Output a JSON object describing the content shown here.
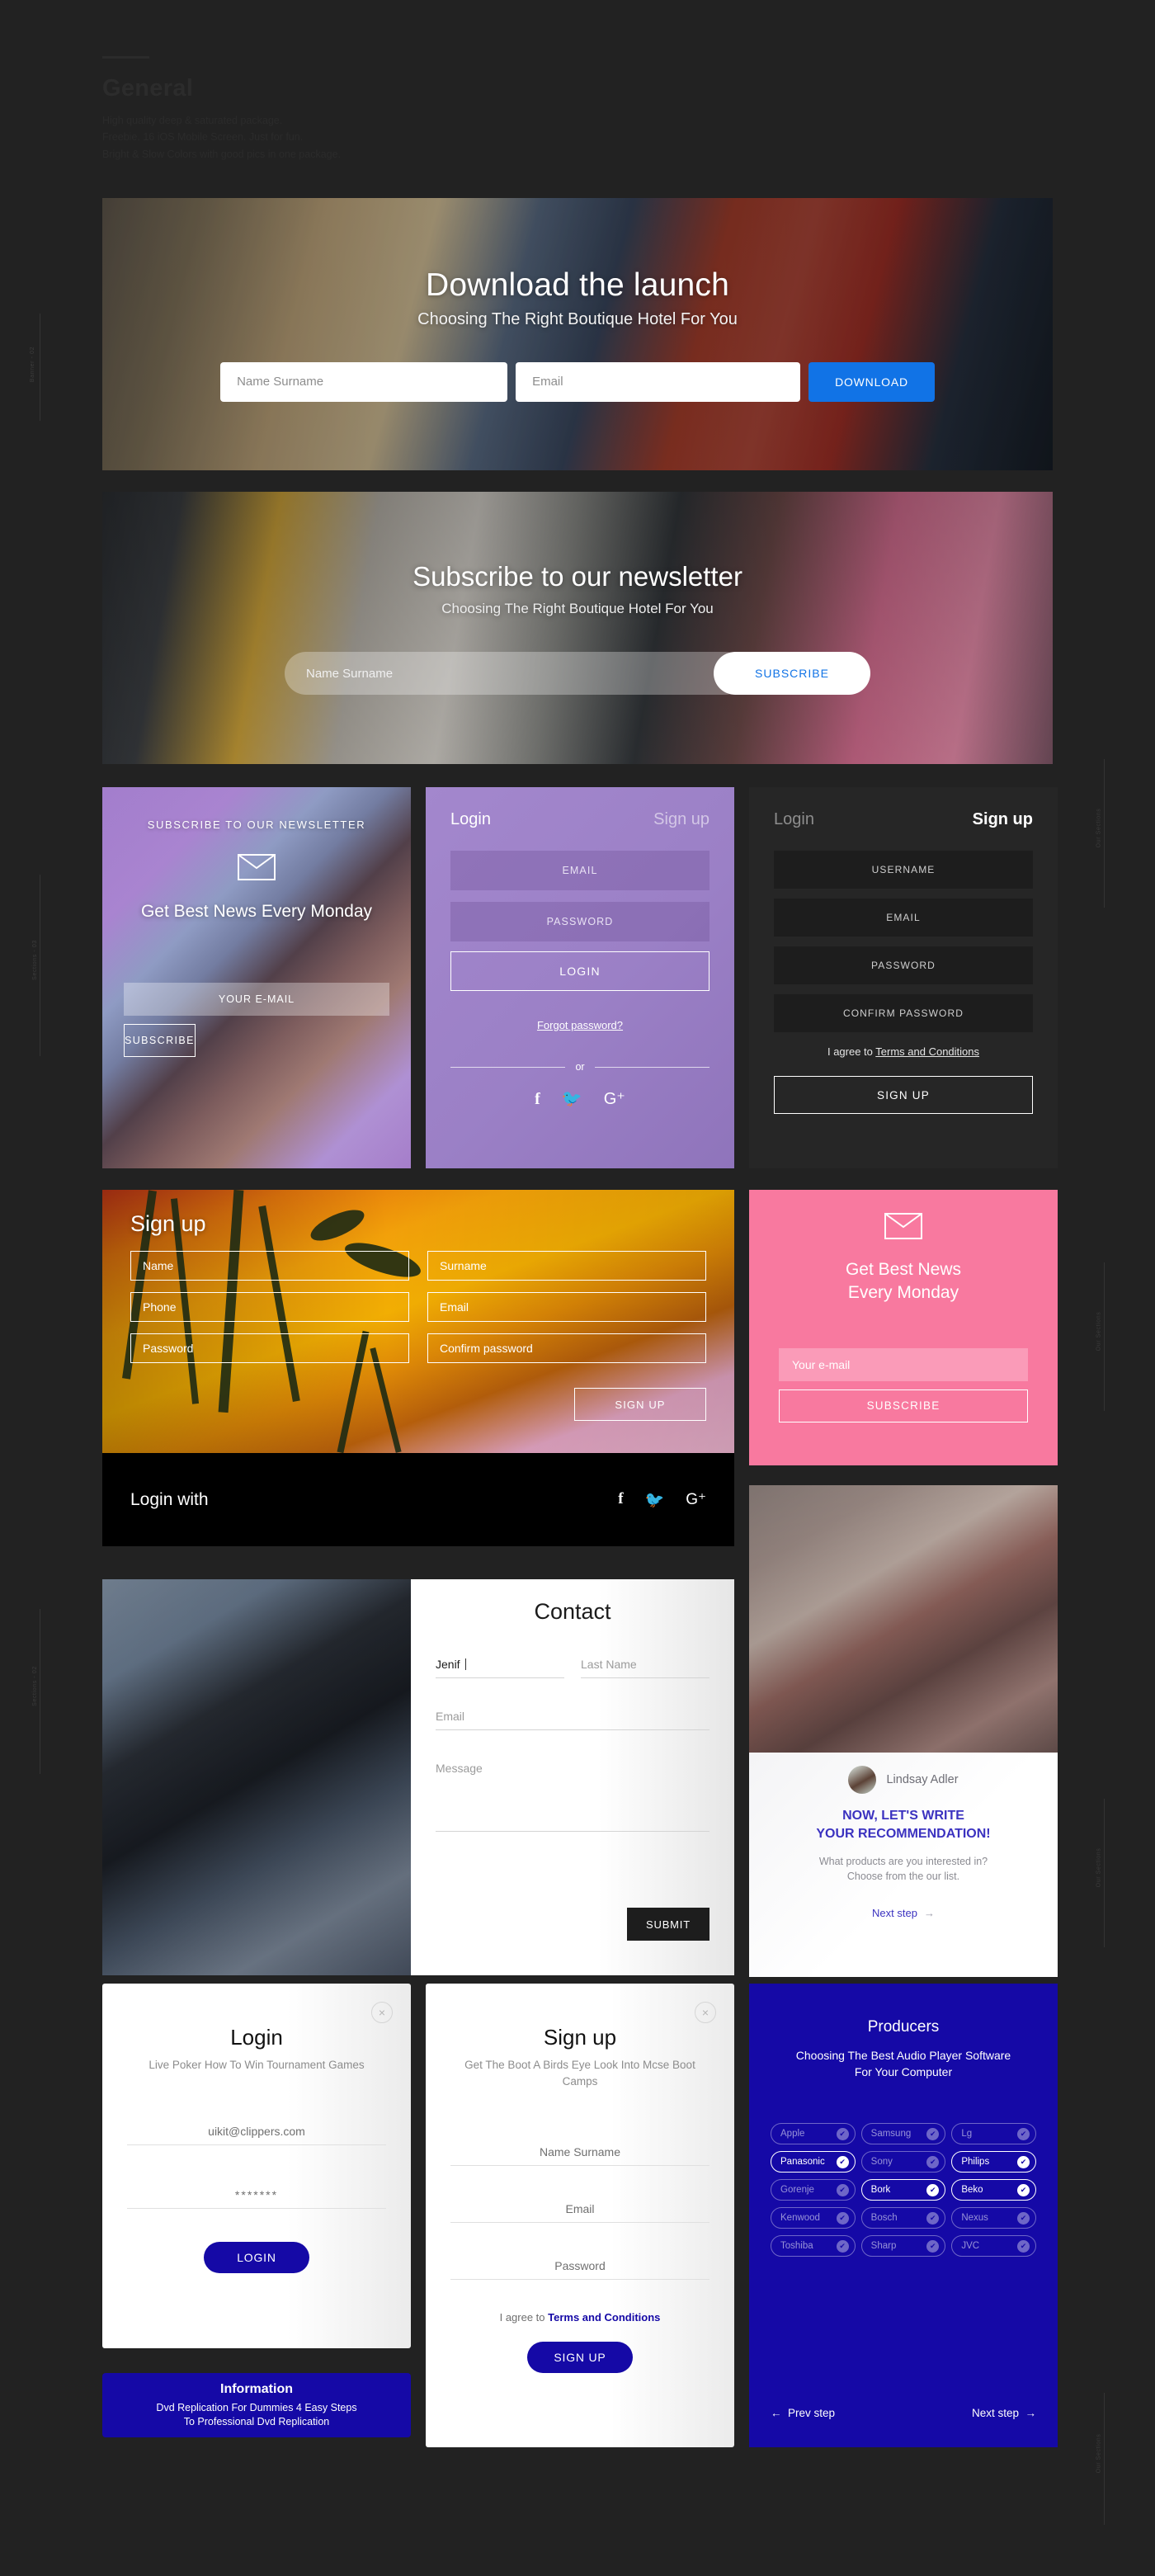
{
  "page": {
    "title": "General",
    "description": "High quality deep & saturated package.\nFreebie. 16 iOS Mobile Screen. Just for fun.\nBright & Slow Colors with good pics in one package."
  },
  "rulers": [
    {
      "label": "Banner - 02"
    },
    {
      "label": "Sections - 03"
    },
    {
      "label": "Sections - 02"
    },
    {
      "label": "Our Sections"
    },
    {
      "label": "Our Sections"
    },
    {
      "label": "Our Sections"
    }
  ],
  "banner_download": {
    "title": "Download the launch",
    "subtitle": "Choosing The Right Boutique Hotel For You",
    "name_placeholder": "Name Surname",
    "email_placeholder": "Email",
    "button": "DOWNLOAD",
    "accent": "#1173e6"
  },
  "banner_subscribe": {
    "title": "Subscribe to our newsletter",
    "subtitle": "Choosing The Right Boutique Hotel For You",
    "name_placeholder": "Name Surname",
    "button": "SUBSCRIBE",
    "accent": "#1173e6"
  },
  "card_newsletter_purple": {
    "eyebrow": "SUBSCRIBE TO OUR NEWSLETTER",
    "title": "Get Best News Every Monday",
    "email_placeholder": "YOUR E-MAIL",
    "button": "SUBSCRIBE"
  },
  "card_login_purple": {
    "tab_login": "Login",
    "tab_signup": "Sign up",
    "email_placeholder": "EMAIL",
    "password_placeholder": "PASSWORD",
    "button": "LOGIN",
    "forgot": "Forgot password?",
    "or": "or",
    "socials": [
      "facebook-icon",
      "twitter-icon",
      "google-plus-icon"
    ]
  },
  "card_signup_dark": {
    "tab_login": "Login",
    "tab_signup": "Sign up",
    "username_placeholder": "USERNAME",
    "email_placeholder": "EMAIL",
    "password_placeholder": "PASSWORD",
    "confirm_placeholder": "CONFIRM PASSWORD",
    "terms_prefix": "I agree to ",
    "terms_link": "Terms and Conditions",
    "button": "SIGN UP"
  },
  "card_tropical_signup": {
    "title": "Sign up",
    "fields": [
      "Name",
      "Surname",
      "Phone",
      "Email",
      "Password",
      "Confirm password"
    ],
    "button": "SIGN UP",
    "login_with": "Login with",
    "socials": [
      "facebook-icon",
      "twitter-icon",
      "google-plus-icon"
    ]
  },
  "card_pink_newsletter": {
    "title": "Get Best News\nEvery Monday",
    "title_line1": "Get Best News",
    "title_line2": "Every Monday",
    "email_placeholder": "Your e-mail",
    "button": "SUBSCRIBE",
    "accent": "#f8799f"
  },
  "card_contact": {
    "title": "Contact",
    "first_name_value": "Jenif",
    "last_name_placeholder": "Last Name",
    "email_placeholder": "Email",
    "message_placeholder": "Message",
    "button": "SUBMIT"
  },
  "card_recommendation": {
    "user_name": "Lindsay Adler",
    "headline_line1": "NOW, LET'S WRITE",
    "headline_line2": "YOUR RECOMMENDATION!",
    "sub_line1": "What products are you interested in?",
    "sub_line2": "Choose from the our list.",
    "next_step": "Next step",
    "accent": "#3b32c0"
  },
  "modal_login": {
    "title": "Login",
    "subtitle": "Live Poker How To Win Tournament Games",
    "email_value": "uikit@clippers.com",
    "password_value": "*******",
    "button": "LOGIN",
    "close": "×"
  },
  "modal_signup": {
    "title": "Sign up",
    "subtitle": "Get The Boot A Birds Eye Look Into Mcse Boot Camps",
    "name_placeholder": "Name Surname",
    "email_placeholder": "Email",
    "password_placeholder": "Password",
    "terms_prefix": "I agree to ",
    "terms_link": "Terms and Conditions",
    "button": "SIGN UP",
    "close": "×"
  },
  "card_producers": {
    "title": "Producers",
    "subtitle_line1": "Choosing The Best Audio Player Software",
    "subtitle_line2": "For Your Computer",
    "chips": [
      {
        "label": "Apple",
        "selected": false
      },
      {
        "label": "Samsung",
        "selected": false
      },
      {
        "label": "Lg",
        "selected": false
      },
      {
        "label": "Panasonic",
        "selected": true
      },
      {
        "label": "Sony",
        "selected": false
      },
      {
        "label": "Philips",
        "selected": true
      },
      {
        "label": "Gorenje",
        "selected": false
      },
      {
        "label": "Bork",
        "selected": true
      },
      {
        "label": "Beko",
        "selected": true
      },
      {
        "label": "Kenwood",
        "selected": false
      },
      {
        "label": "Bosch",
        "selected": false
      },
      {
        "label": "Nexus",
        "selected": false
      },
      {
        "label": "Toshiba",
        "selected": false
      },
      {
        "label": "Sharp",
        "selected": false
      },
      {
        "label": "JVC",
        "selected": false
      }
    ],
    "prev_step": "Prev step",
    "next_step": "Next step",
    "accent": "#1509a6"
  },
  "card_information": {
    "title": "Information",
    "line1": "Dvd Replication For Dummies 4 Easy Steps",
    "line2": "To Professional Dvd Replication",
    "accent": "#1509a6"
  }
}
